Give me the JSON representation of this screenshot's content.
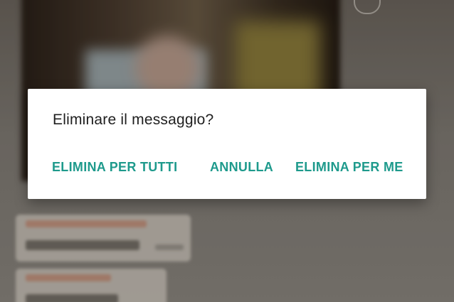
{
  "dialog": {
    "title": "Eliminare il messaggio?",
    "actions": {
      "delete_for_everyone": "ELIMINA PER TUTTI",
      "cancel": "ANNULLA",
      "delete_for_me": "ELIMINA PER ME"
    }
  },
  "colors": {
    "accent": "#1e9a8c",
    "dialog_background": "#ffffff",
    "title_text": "#202020"
  }
}
